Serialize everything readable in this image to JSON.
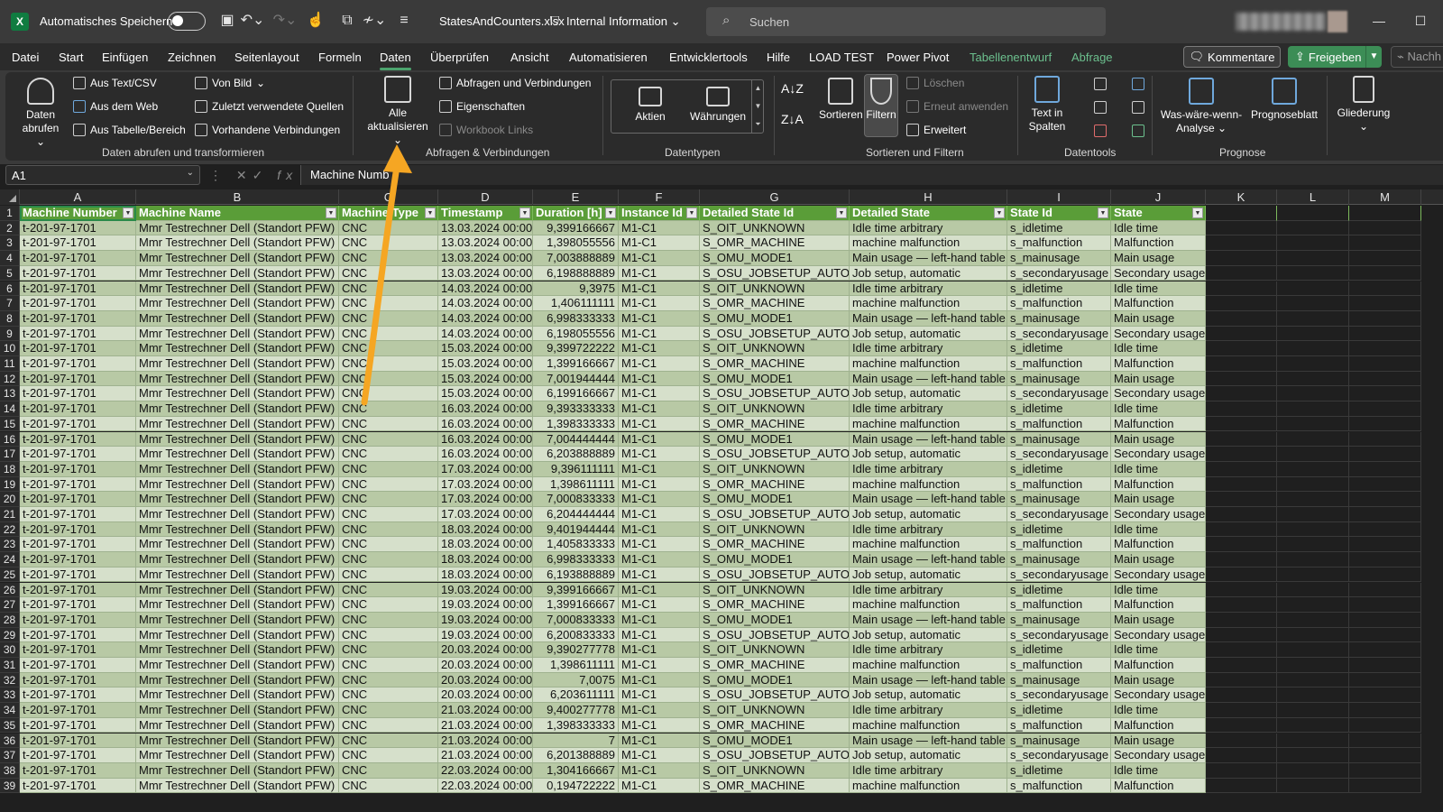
{
  "titlebar": {
    "autosave_label": "Automatisches Speichern",
    "filename": "StatesAndCounters.xlsx",
    "sensitivity": "Internal Information",
    "search_placeholder": "Suchen"
  },
  "menu": {
    "tabs": [
      "Datei",
      "Start",
      "Einfügen",
      "Zeichnen",
      "Seitenlayout",
      "Formeln",
      "Daten",
      "Überprüfen",
      "Ansicht",
      "Automatisieren",
      "Entwicklertools",
      "Hilfe",
      "LOAD TEST",
      "Power Pivot",
      "Tabellenentwurf",
      "Abfrage"
    ],
    "active": "Daten",
    "kommentare": "Kommentare",
    "freigeben": "Freigeben",
    "nachh": "Nachh"
  },
  "ribbon": {
    "daten_abrufen": [
      "Daten",
      "abrufen"
    ],
    "aus_text_csv": "Aus Text/CSV",
    "aus_dem_web": "Aus dem Web",
    "aus_tabelle": "Aus Tabelle/Bereich",
    "von_bild": "Von Bild",
    "zuletzt": "Zuletzt verwendete Quellen",
    "vorhandene": "Vorhandene Verbindungen",
    "group1": "Daten abrufen und transformieren",
    "alle_aktualisieren": [
      "Alle",
      "aktualisieren"
    ],
    "abfragen_verbindungen": "Abfragen und Verbindungen",
    "eigenschaften": "Eigenschaften",
    "workbook_links": "Workbook Links",
    "group2": "Abfragen & Verbindungen",
    "aktien": "Aktien",
    "waehrungen": "Währungen",
    "group3": "Datentypen",
    "sortieren": "Sortieren",
    "filtern": "Filtern",
    "loeschen": "Löschen",
    "erneut_anwenden": "Erneut anwenden",
    "erweitert": "Erweitert",
    "group4": "Sortieren und Filtern",
    "text_in_spalten": [
      "Text in",
      "Spalten"
    ],
    "group5": "Datentools",
    "was_waere_wenn": [
      "Was-wäre-wenn-",
      "Analyse"
    ],
    "prognoseblatt": "Prognoseblatt",
    "group6": "Prognose",
    "gliederung": "Gliederung"
  },
  "formula_bar": {
    "namebox": "A1",
    "formula": "Machine Numb"
  },
  "grid": {
    "columns": [
      "A",
      "B",
      "C",
      "D",
      "E",
      "F",
      "G",
      "H",
      "I",
      "J",
      "K",
      "L",
      "M"
    ],
    "headers": [
      "Machine Number",
      "Machine Name",
      "Machine Type",
      "Timestamp",
      "Duration [h]",
      "Instance Id",
      "Detailed State Id",
      "Detailed State",
      "State Id",
      "State"
    ],
    "rows": [
      [
        "t-201-97-1701",
        "Mmr Testrechner Dell (Standort PFW)",
        "CNC",
        "13.03.2024 00:00",
        "9,399166667",
        "M1-C1",
        "S_OIT_UNKNOWN",
        "Idle time arbitrary",
        "s_idletime",
        "Idle time"
      ],
      [
        "t-201-97-1701",
        "Mmr Testrechner Dell (Standort PFW)",
        "CNC",
        "13.03.2024 00:00",
        "1,398055556",
        "M1-C1",
        "S_OMR_MACHINE",
        "machine malfunction",
        "s_malfunction",
        "Malfunction"
      ],
      [
        "t-201-97-1701",
        "Mmr Testrechner Dell (Standort PFW)",
        "CNC",
        "13.03.2024 00:00",
        "7,003888889",
        "M1-C1",
        "S_OMU_MODE1",
        "Main usage — left-hand table",
        "s_mainusage",
        "Main usage"
      ],
      [
        "t-201-97-1701",
        "Mmr Testrechner Dell (Standort PFW)",
        "CNC",
        "13.03.2024 00:00",
        "6,198888889",
        "M1-C1",
        "S_OSU_JOBSETUP_AUTO",
        "Job setup, automatic",
        "s_secondaryusage",
        "Secondary usage"
      ],
      [
        "t-201-97-1701",
        "Mmr Testrechner Dell (Standort PFW)",
        "CNC",
        "14.03.2024 00:00",
        "9,3975",
        "M1-C1",
        "S_OIT_UNKNOWN",
        "Idle time arbitrary",
        "s_idletime",
        "Idle time"
      ],
      [
        "t-201-97-1701",
        "Mmr Testrechner Dell (Standort PFW)",
        "CNC",
        "14.03.2024 00:00",
        "1,406111111",
        "M1-C1",
        "S_OMR_MACHINE",
        "machine malfunction",
        "s_malfunction",
        "Malfunction"
      ],
      [
        "t-201-97-1701",
        "Mmr Testrechner Dell (Standort PFW)",
        "CNC",
        "14.03.2024 00:00",
        "6,998333333",
        "M1-C1",
        "S_OMU_MODE1",
        "Main usage — left-hand table",
        "s_mainusage",
        "Main usage"
      ],
      [
        "t-201-97-1701",
        "Mmr Testrechner Dell (Standort PFW)",
        "CNC",
        "14.03.2024 00:00",
        "6,198055556",
        "M1-C1",
        "S_OSU_JOBSETUP_AUTO",
        "Job setup, automatic",
        "s_secondaryusage",
        "Secondary usage"
      ],
      [
        "t-201-97-1701",
        "Mmr Testrechner Dell (Standort PFW)",
        "CNC",
        "15.03.2024 00:00",
        "9,399722222",
        "M1-C1",
        "S_OIT_UNKNOWN",
        "Idle time arbitrary",
        "s_idletime",
        "Idle time"
      ],
      [
        "t-201-97-1701",
        "Mmr Testrechner Dell (Standort PFW)",
        "CNC",
        "15.03.2024 00:00",
        "1,399166667",
        "M1-C1",
        "S_OMR_MACHINE",
        "machine malfunction",
        "s_malfunction",
        "Malfunction"
      ],
      [
        "t-201-97-1701",
        "Mmr Testrechner Dell (Standort PFW)",
        "CNC",
        "15.03.2024 00:00",
        "7,001944444",
        "M1-C1",
        "S_OMU_MODE1",
        "Main usage — left-hand table",
        "s_mainusage",
        "Main usage"
      ],
      [
        "t-201-97-1701",
        "Mmr Testrechner Dell (Standort PFW)",
        "CNC",
        "15.03.2024 00:00",
        "6,199166667",
        "M1-C1",
        "S_OSU_JOBSETUP_AUTO",
        "Job setup, automatic",
        "s_secondaryusage",
        "Secondary usage"
      ],
      [
        "t-201-97-1701",
        "Mmr Testrechner Dell (Standort PFW)",
        "CNC",
        "16.03.2024 00:00",
        "9,393333333",
        "M1-C1",
        "S_OIT_UNKNOWN",
        "Idle time arbitrary",
        "s_idletime",
        "Idle time"
      ],
      [
        "t-201-97-1701",
        "Mmr Testrechner Dell (Standort PFW)",
        "CNC",
        "16.03.2024 00:00",
        "1,398333333",
        "M1-C1",
        "S_OMR_MACHINE",
        "machine malfunction",
        "s_malfunction",
        "Malfunction"
      ],
      [
        "t-201-97-1701",
        "Mmr Testrechner Dell (Standort PFW)",
        "CNC",
        "16.03.2024 00:00",
        "7,004444444",
        "M1-C1",
        "S_OMU_MODE1",
        "Main usage — left-hand table",
        "s_mainusage",
        "Main usage"
      ],
      [
        "t-201-97-1701",
        "Mmr Testrechner Dell (Standort PFW)",
        "CNC",
        "16.03.2024 00:00",
        "6,203888889",
        "M1-C1",
        "S_OSU_JOBSETUP_AUTO",
        "Job setup, automatic",
        "s_secondaryusage",
        "Secondary usage"
      ],
      [
        "t-201-97-1701",
        "Mmr Testrechner Dell (Standort PFW)",
        "CNC",
        "17.03.2024 00:00",
        "9,396111111",
        "M1-C1",
        "S_OIT_UNKNOWN",
        "Idle time arbitrary",
        "s_idletime",
        "Idle time"
      ],
      [
        "t-201-97-1701",
        "Mmr Testrechner Dell (Standort PFW)",
        "CNC",
        "17.03.2024 00:00",
        "1,398611111",
        "M1-C1",
        "S_OMR_MACHINE",
        "machine malfunction",
        "s_malfunction",
        "Malfunction"
      ],
      [
        "t-201-97-1701",
        "Mmr Testrechner Dell (Standort PFW)",
        "CNC",
        "17.03.2024 00:00",
        "7,000833333",
        "M1-C1",
        "S_OMU_MODE1",
        "Main usage — left-hand table",
        "s_mainusage",
        "Main usage"
      ],
      [
        "t-201-97-1701",
        "Mmr Testrechner Dell (Standort PFW)",
        "CNC",
        "17.03.2024 00:00",
        "6,204444444",
        "M1-C1",
        "S_OSU_JOBSETUP_AUTO",
        "Job setup, automatic",
        "s_secondaryusage",
        "Secondary usage"
      ],
      [
        "t-201-97-1701",
        "Mmr Testrechner Dell (Standort PFW)",
        "CNC",
        "18.03.2024 00:00",
        "9,401944444",
        "M1-C1",
        "S_OIT_UNKNOWN",
        "Idle time arbitrary",
        "s_idletime",
        "Idle time"
      ],
      [
        "t-201-97-1701",
        "Mmr Testrechner Dell (Standort PFW)",
        "CNC",
        "18.03.2024 00:00",
        "1,405833333",
        "M1-C1",
        "S_OMR_MACHINE",
        "machine malfunction",
        "s_malfunction",
        "Malfunction"
      ],
      [
        "t-201-97-1701",
        "Mmr Testrechner Dell (Standort PFW)",
        "CNC",
        "18.03.2024 00:00",
        "6,998333333",
        "M1-C1",
        "S_OMU_MODE1",
        "Main usage — left-hand table",
        "s_mainusage",
        "Main usage"
      ],
      [
        "t-201-97-1701",
        "Mmr Testrechner Dell (Standort PFW)",
        "CNC",
        "18.03.2024 00:00",
        "6,193888889",
        "M1-C1",
        "S_OSU_JOBSETUP_AUTO",
        "Job setup, automatic",
        "s_secondaryusage",
        "Secondary usage"
      ],
      [
        "t-201-97-1701",
        "Mmr Testrechner Dell (Standort PFW)",
        "CNC",
        "19.03.2024 00:00",
        "9,399166667",
        "M1-C1",
        "S_OIT_UNKNOWN",
        "Idle time arbitrary",
        "s_idletime",
        "Idle time"
      ],
      [
        "t-201-97-1701",
        "Mmr Testrechner Dell (Standort PFW)",
        "CNC",
        "19.03.2024 00:00",
        "1,399166667",
        "M1-C1",
        "S_OMR_MACHINE",
        "machine malfunction",
        "s_malfunction",
        "Malfunction"
      ],
      [
        "t-201-97-1701",
        "Mmr Testrechner Dell (Standort PFW)",
        "CNC",
        "19.03.2024 00:00",
        "7,000833333",
        "M1-C1",
        "S_OMU_MODE1",
        "Main usage — left-hand table",
        "s_mainusage",
        "Main usage"
      ],
      [
        "t-201-97-1701",
        "Mmr Testrechner Dell (Standort PFW)",
        "CNC",
        "19.03.2024 00:00",
        "6,200833333",
        "M1-C1",
        "S_OSU_JOBSETUP_AUTO",
        "Job setup, automatic",
        "s_secondaryusage",
        "Secondary usage"
      ],
      [
        "t-201-97-1701",
        "Mmr Testrechner Dell (Standort PFW)",
        "CNC",
        "20.03.2024 00:00",
        "9,390277778",
        "M1-C1",
        "S_OIT_UNKNOWN",
        "Idle time arbitrary",
        "s_idletime",
        "Idle time"
      ],
      [
        "t-201-97-1701",
        "Mmr Testrechner Dell (Standort PFW)",
        "CNC",
        "20.03.2024 00:00",
        "1,398611111",
        "M1-C1",
        "S_OMR_MACHINE",
        "machine malfunction",
        "s_malfunction",
        "Malfunction"
      ],
      [
        "t-201-97-1701",
        "Mmr Testrechner Dell (Standort PFW)",
        "CNC",
        "20.03.2024 00:00",
        "7,0075",
        "M1-C1",
        "S_OMU_MODE1",
        "Main usage — left-hand table",
        "s_mainusage",
        "Main usage"
      ],
      [
        "t-201-97-1701",
        "Mmr Testrechner Dell (Standort PFW)",
        "CNC",
        "20.03.2024 00:00",
        "6,203611111",
        "M1-C1",
        "S_OSU_JOBSETUP_AUTO",
        "Job setup, automatic",
        "s_secondaryusage",
        "Secondary usage"
      ],
      [
        "t-201-97-1701",
        "Mmr Testrechner Dell (Standort PFW)",
        "CNC",
        "21.03.2024 00:00",
        "9,400277778",
        "M1-C1",
        "S_OIT_UNKNOWN",
        "Idle time arbitrary",
        "s_idletime",
        "Idle time"
      ],
      [
        "t-201-97-1701",
        "Mmr Testrechner Dell (Standort PFW)",
        "CNC",
        "21.03.2024 00:00",
        "1,398333333",
        "M1-C1",
        "S_OMR_MACHINE",
        "machine malfunction",
        "s_malfunction",
        "Malfunction"
      ],
      [
        "t-201-97-1701",
        "Mmr Testrechner Dell (Standort PFW)",
        "CNC",
        "21.03.2024 00:00",
        "7",
        "M1-C1",
        "S_OMU_MODE1",
        "Main usage — left-hand table",
        "s_mainusage",
        "Main usage"
      ],
      [
        "t-201-97-1701",
        "Mmr Testrechner Dell (Standort PFW)",
        "CNC",
        "21.03.2024 00:00",
        "6,201388889",
        "M1-C1",
        "S_OSU_JOBSETUP_AUTO",
        "Job setup, automatic",
        "s_secondaryusage",
        "Secondary usage"
      ],
      [
        "t-201-97-1701",
        "Mmr Testrechner Dell (Standort PFW)",
        "CNC",
        "22.03.2024 00:00",
        "1,304166667",
        "M1-C1",
        "S_OIT_UNKNOWN",
        "Idle time arbitrary",
        "s_idletime",
        "Idle time"
      ],
      [
        "t-201-97-1701",
        "Mmr Testrechner Dell (Standort PFW)",
        "CNC",
        "22.03.2024 00:00",
        "0,194722222",
        "M1-C1",
        "S_OMR_MACHINE",
        "machine malfunction",
        "s_malfunction",
        "Malfunction"
      ]
    ]
  },
  "annotation": {
    "arrow_color": "#f5a623"
  }
}
